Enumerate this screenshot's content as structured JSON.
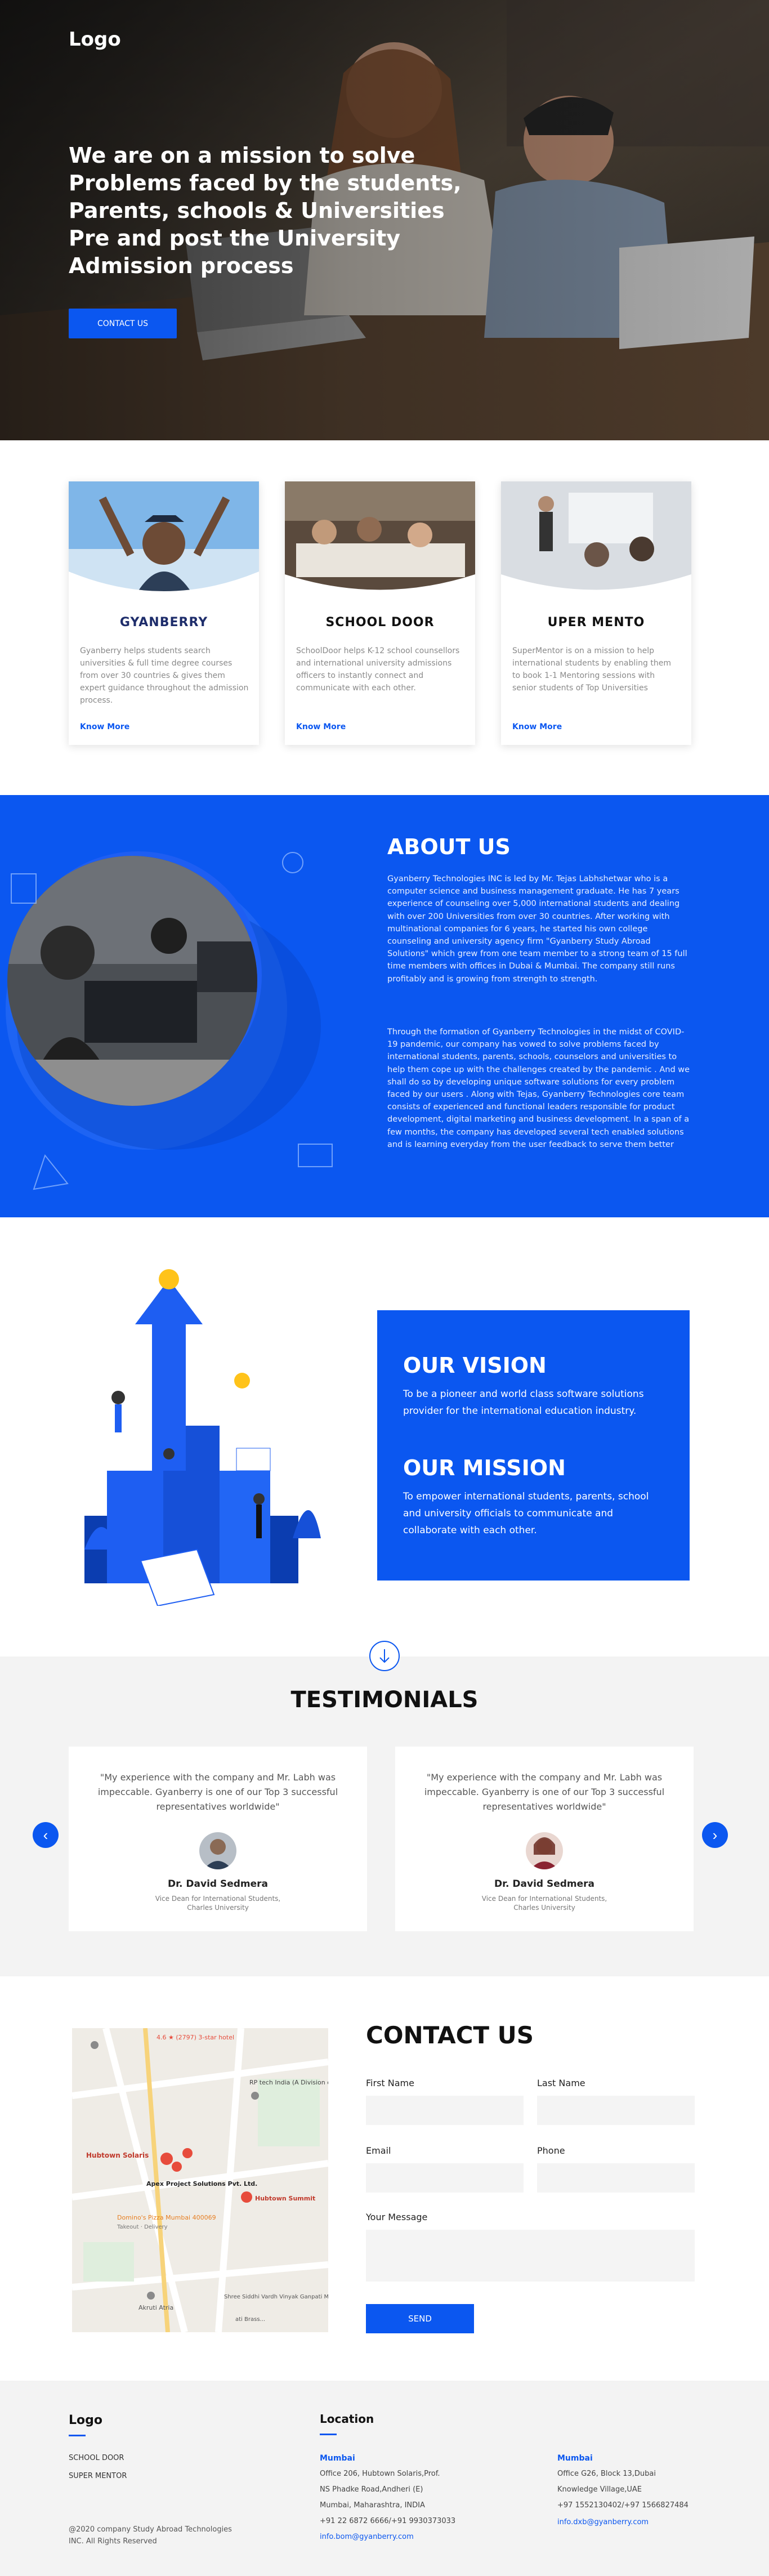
{
  "hero": {
    "logo": "Logo",
    "headline_lines": [
      "We are on a mission to solve",
      "Problems faced by the students,",
      "Parents, schools & Universities",
      "Pre and post the University",
      "Admission process"
    ],
    "cta_label": "CONTACT US"
  },
  "products": [
    {
      "brand": "GYANBERRY",
      "description": "Gyanberry helps students search universities & full time degree courses from over 30 countries & gives them expert guidance throughout the admission process.",
      "link": "Know More"
    },
    {
      "brand": "SCHOOL DOOR",
      "description": "SchoolDoor helps K-12 school counsellors and international university admissions officers to instantly connect and communicate with each other.",
      "link": "Know More"
    },
    {
      "brand": "UPER MENTO",
      "description": "SuperMentor is on a mission to help international students by enabling them to book 1-1 Mentoring sessions with senior students of Top Universities",
      "link": "Know More"
    }
  ],
  "about": {
    "title": "ABOUT US",
    "p1": "Gyanberry Technologies INC is led by Mr. Tejas Labhshetwar who is a computer science and business management graduate. He has 7 years experience of counseling over 5,000 international students and dealing with over 200 Universities from over 30 countries. After working with multinational companies for 6 years, he started his own college counseling and university agency firm \"Gyanberry Study Abroad Solutions\" which grew from one team member to a strong team of 15 full time members with offices in Dubai & Mumbai. The company still runs profitably and is growing from strength to strength.",
    "p2": "Through the formation of Gyanberry Technologies in the midst of COVID-19 pandemic, our company has vowed to solve problems faced by international students, parents, schools, counselors and universities to help them cope up with the challenges created by the pandemic . And we shall do so by developing unique software solutions for every problem faced by our users . Along with Tejas, Gyanberry Technologies core team consists of experienced and functional leaders responsible for product development, digital marketing and business development. In a span of a few months, the company has developed several tech enabled solutions and is learning everyday from the user feedback to serve them better"
  },
  "vision": {
    "vision_title": "OUR VISION",
    "vision_text": "To be a pioneer and world class software solutions provider for the international education industry.",
    "mission_title": "OUR MISSION",
    "mission_text": "To empower international students, parents, school and university officials to communicate and collaborate with each other."
  },
  "testimonials": {
    "title": "TESTIMONIALS",
    "items": [
      {
        "quote": "\"My experience with the company and Mr. Labh was impeccable. Gyanberry is one of our Top 3 successful representatives worldwide\"",
        "name": "Dr. David Sedmera",
        "role": "Vice Dean for International Students, Charles University"
      },
      {
        "quote": "\"My experience with the company and Mr. Labh was impeccable. Gyanberry is one of our Top 3 successful representatives worldwide\"",
        "name": "Dr. David Sedmera",
        "role": "Vice Dean for International Students, Charles University"
      }
    ],
    "prev_icon": "chevron-left-icon",
    "next_icon": "chevron-right-icon"
  },
  "contact": {
    "title": "CONTACT US",
    "first_name_label": "First Name",
    "last_name_label": "Last Name",
    "email_label": "Email",
    "phone_label": "Phone",
    "message_label": "Your Message",
    "send_label": "SEND",
    "map_labels": {
      "hotel": "4.6 ★ (2797) 3-star hotel",
      "rp_tech": "RP tech India (A Division of Rashi...",
      "hubtown_solaris": "Hubtown Solaris",
      "apex": "Apex Project Solutions Pvt. Ltd.",
      "dominos": "Domino's Pizza Mumbai 400069",
      "dominos_sub": "Takeout · Delivery",
      "hubtown_summit": "Hubtown Summit",
      "akruti": "Akruti Atria",
      "shree": "Shree Siddhi Vardh Vinyak Ganpati Mandir",
      "brass": "ati Brass..."
    }
  },
  "footer": {
    "logo": "Logo",
    "links": [
      "SCHOOL DOOR",
      "SUPER MENTOR"
    ],
    "copyright": "@2020 company Study Abroad Technologies INC. All Rights Reserved",
    "location_title": "Location",
    "offices": [
      {
        "city": "Mumbai",
        "lines": [
          "Office 206, Hubtown Solaris,Prof.",
          "NS Phadke Road,Andheri (E)",
          "Mumbai, Maharashtra, INDIA",
          "+91 22 6872 6666/+91 9930373033"
        ],
        "email": "info.bom@gyanberry.com"
      },
      {
        "city": "Mumbai",
        "lines": [
          "Office G26, Block 13,Dubai",
          "Knowledge Village,UAE",
          "+97 1552130402/+97 1566827484"
        ],
        "email": "info.dxb@gyanberry.com"
      }
    ]
  },
  "colors": {
    "brand_blue": "#0b57f0",
    "light_bg": "#f3f3f3"
  }
}
